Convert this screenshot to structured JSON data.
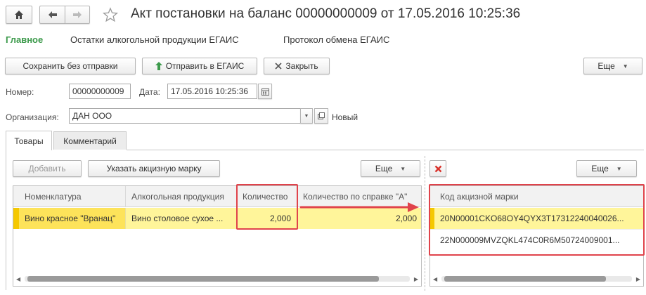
{
  "window": {
    "title": "Акт постановки на баланс 00000000009 от 17.05.2016 10:25:36"
  },
  "nav_tabs": [
    "Главное",
    "Остатки алкогольной продукции ЕГАИС",
    "Протокол обмена ЕГАИС"
  ],
  "toolbar": {
    "save_label": "Сохранить без отправки",
    "send_label": "Отправить в ЕГАИС",
    "close_label": "Закрыть",
    "more_label": "Еще"
  },
  "form": {
    "number_label": "Номер:",
    "number_value": "00000000009",
    "date_label": "Дата:",
    "date_value": "17.05.2016 10:25:36",
    "org_label": "Организация:",
    "org_value": "ДАН ООО",
    "status": "Новый"
  },
  "tabs": [
    "Товары",
    "Комментарий"
  ],
  "goods": {
    "add_label": "Добавить",
    "specify_label": "Указать акцизную марку",
    "more_label": "Еще",
    "columns": [
      "Номенклатура",
      "Алкогольная продукция",
      "Количество",
      "Количество по справке \"А\""
    ],
    "rows": [
      {
        "nomenclature": "Вино красное \"Вранац\"",
        "product": "Вино столовое сухое ...",
        "quantity": "2,000",
        "quantity_ref": "2,000"
      }
    ]
  },
  "marks": {
    "more_label": "Еще",
    "column": "Код акцизной марки",
    "rows": [
      "20N00001CKO68OY4QYX3T17312240040026...",
      "22N000009MVZQKL474C0R6M50724009001..."
    ]
  },
  "colors": {
    "accent_green": "#3c9a4b",
    "selected_row": "#fff59a",
    "highlight_red": "#e0434b"
  },
  "icons": {
    "home": "home-icon",
    "back": "arrow-left-icon",
    "forward": "arrow-right-icon",
    "favorite": "star-icon",
    "send": "green-arrow-up-icon",
    "close": "close-icon",
    "calendar": "calendar-icon",
    "delete": "red-x-icon"
  }
}
